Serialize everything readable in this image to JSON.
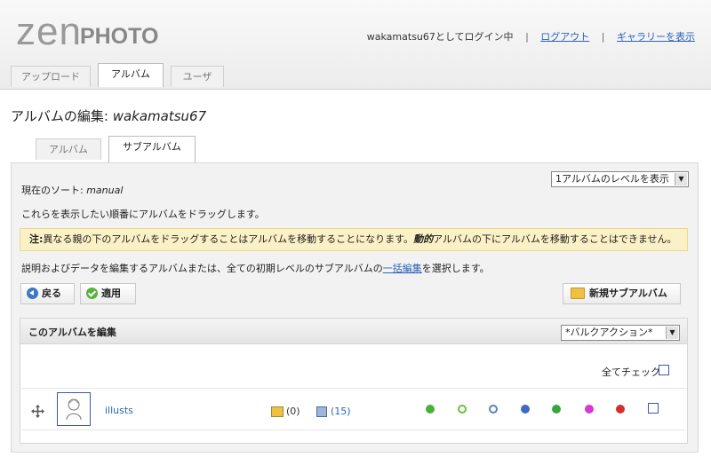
{
  "logo": {
    "zen": "zen",
    "photo": "PHOTO"
  },
  "userbar": {
    "login_status": "wakamatsu67としてログイン中",
    "logout": "ログアウト",
    "view_gallery": "ギャラリーを表示"
  },
  "main_tabs": [
    {
      "label": "アップロード",
      "active": false
    },
    {
      "label": "アルバム",
      "active": true
    },
    {
      "label": "ユーザ",
      "active": false
    }
  ],
  "page_title": {
    "prefix": "アルバムの編集: ",
    "album": "wakamatsu67"
  },
  "sub_tabs": [
    {
      "label": "アルバム",
      "active": false
    },
    {
      "label": "サブアルバム",
      "active": true
    }
  ],
  "sort": {
    "label": "現在のソート:",
    "value": "manual"
  },
  "level_select": {
    "value": "1アルバムのレベルを表示"
  },
  "drag_hint": "これらを表示したい順番にアルバムをドラッグします。",
  "notice": {
    "bold": "注:",
    "text1": "異なる親の下のアルバムをドラッグすることはアルバムを移動することになります。",
    "italic": "動的",
    "text2": "アルバムの下にアルバムを移動することはできません。"
  },
  "info": {
    "text1": "説明およびデータを編集するアルバムまたは、全ての初期レベルのサブアルバムの",
    "link": "一括編集",
    "text2": "を選択します。"
  },
  "buttons": {
    "back": "戻る",
    "apply": "適用",
    "new_subalbum": "新規サブアルバム"
  },
  "edit_section": {
    "title": "このアルバムを編集",
    "bulk_action": "*バルクアクション*",
    "check_all": "全てチェック"
  },
  "albums": [
    {
      "name": "illusts",
      "subalbum_count": "(0)",
      "image_count": "(15)"
    }
  ],
  "status_icons": [
    {
      "name": "published-icon",
      "color": "#4caf38"
    },
    {
      "name": "comments-icon",
      "color": "#6abf3e"
    },
    {
      "name": "cache-icon",
      "color": "#5b80c6"
    },
    {
      "name": "hitcounter-icon",
      "color": "#3d6bc2"
    },
    {
      "name": "refresh-icon",
      "color": "#39a63b"
    },
    {
      "name": "remove-icon",
      "color": "#d63ad0"
    },
    {
      "name": "delete-icon",
      "color": "#d32f2f"
    }
  ]
}
